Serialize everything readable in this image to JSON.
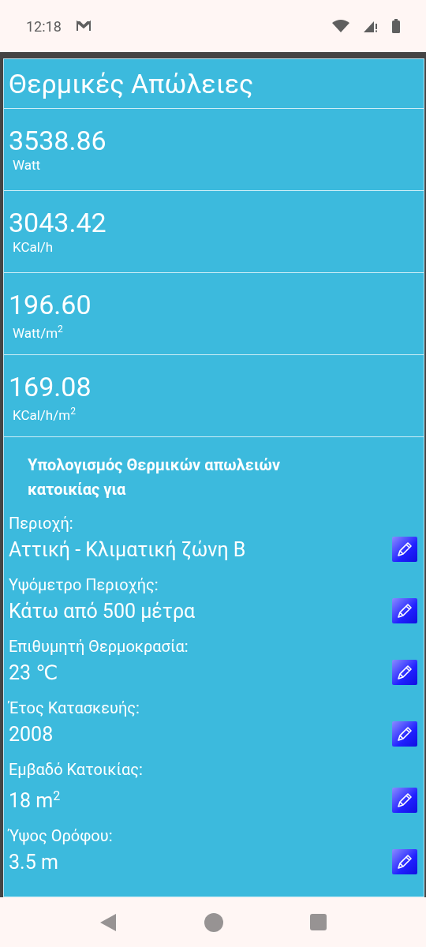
{
  "status_bar": {
    "time": "12:18"
  },
  "title": "Θερμικές Απώλειες",
  "results": [
    {
      "value": "3538.86",
      "unit": "Watt"
    },
    {
      "value": "3043.42",
      "unit": "KCal/h"
    },
    {
      "value": "196.60",
      "unit": "Watt/m$^{2}$"
    },
    {
      "value": "169.08",
      "unit": "KCal/h/m$^{2}$"
    }
  ],
  "section_heading": "Υπολογισμός Θερμικών απωλειών κατοικίας για",
  "parameters": [
    {
      "label": "Περιοχή:",
      "value": "Αττική - Κλιματική ζώνη Β"
    },
    {
      "label": "Υψόμετρο Περιοχής:",
      "value": "Κάτω από 500 μέτρα"
    },
    {
      "label": "Επιθυμητή Θερμοκρασία:",
      "value": "23 ℃"
    },
    {
      "label": "Έτος Κατασκευής:",
      "value": "2008"
    },
    {
      "label": "Εμβαδό Κατοικίας:",
      "value": "18 m$^{2}$"
    },
    {
      "label": "Ύψος Ορόφου:",
      "value": "3.5 m"
    }
  ]
}
